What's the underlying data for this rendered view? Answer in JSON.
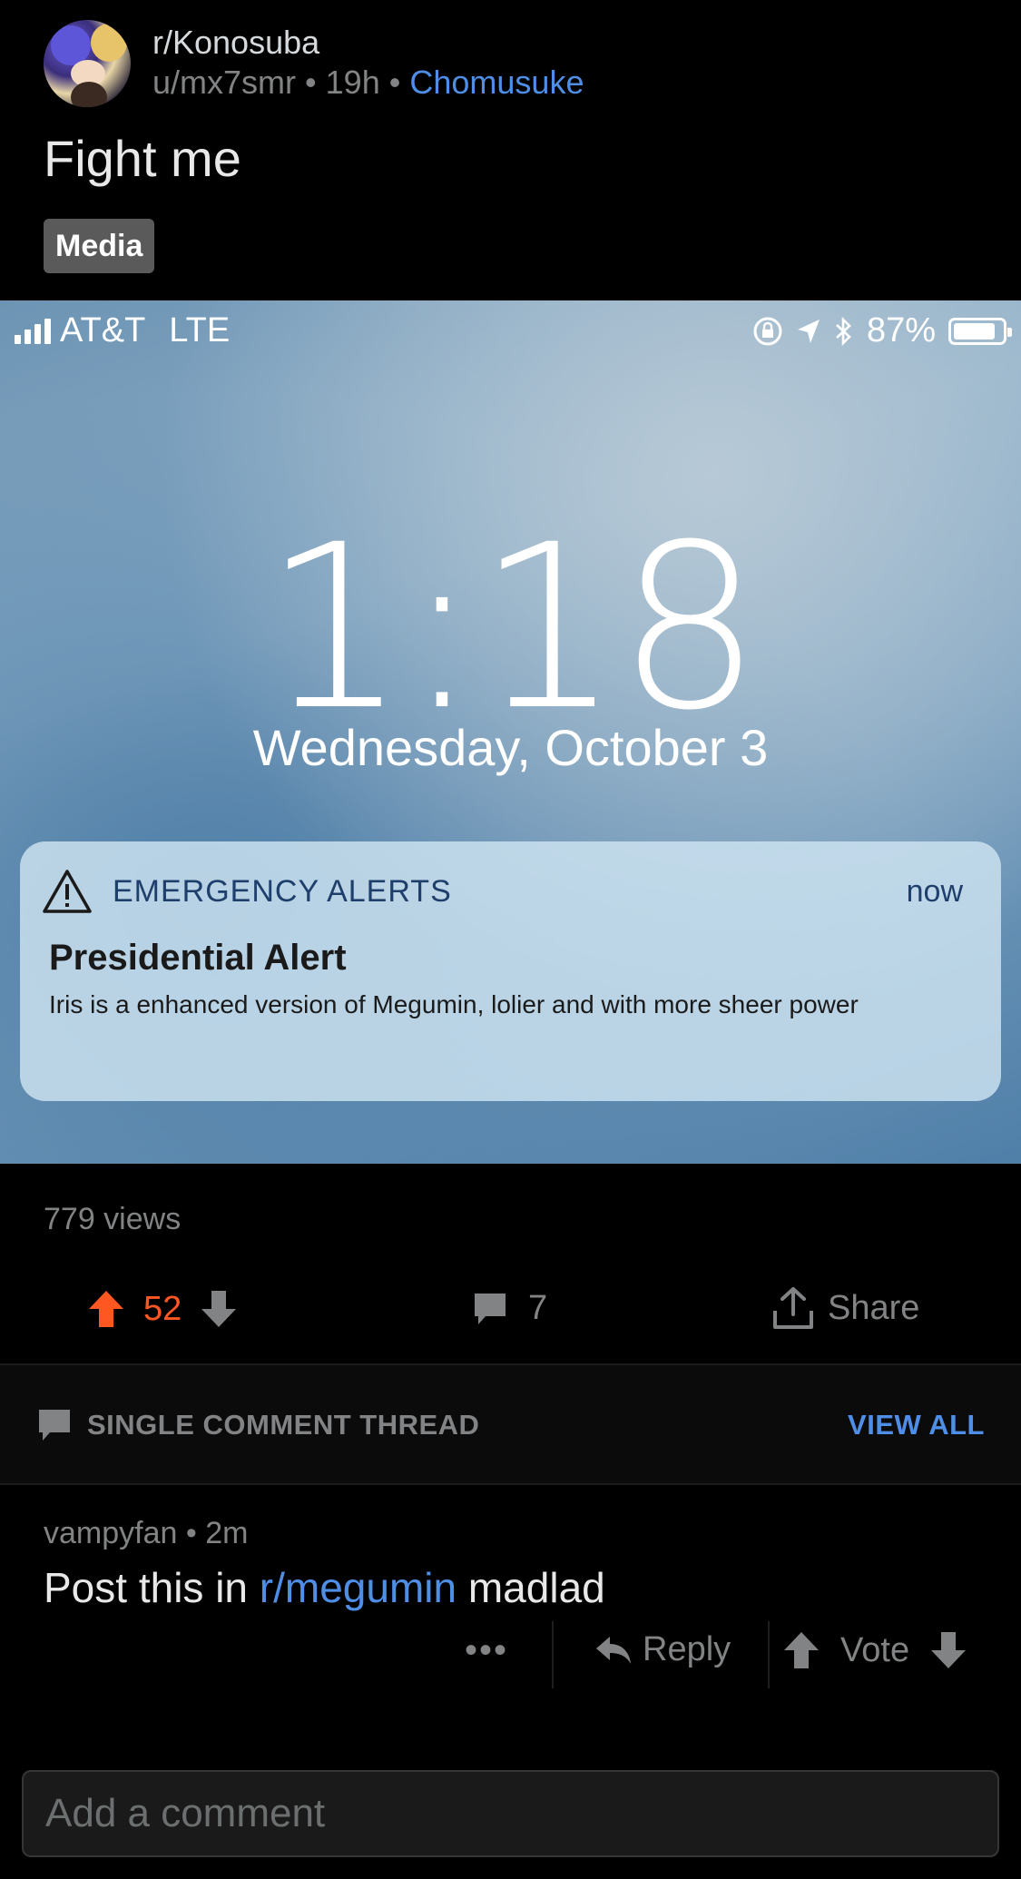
{
  "post": {
    "subreddit": "r/Konosuba",
    "username": "u/mx7smr",
    "age": "19h",
    "flair": "Chomusuke",
    "sep": "•",
    "title": "Fight me",
    "tag": "Media"
  },
  "media": {
    "carrier": "AT&T",
    "network": "LTE",
    "battery_text": "87%",
    "battery_level": 0.87,
    "clock": "1:18",
    "date": "Wednesday, October 3",
    "alert": {
      "app": "EMERGENCY ALERTS",
      "time": "now",
      "headline": "Presidential Alert",
      "body": "Iris is a enhanced version of Megumin, lolier and with more sheer power"
    }
  },
  "stats": {
    "views": "779 views",
    "score": "52",
    "comments": "7",
    "share_label": "Share"
  },
  "thread": {
    "label": "SINGLE COMMENT THREAD",
    "view_all": "VIEW ALL"
  },
  "comment": {
    "author": "vampyfan",
    "age": "2m",
    "sep": "•",
    "text_before": "Post this in ",
    "link": "r/megumin",
    "text_after": " madlad",
    "more": "•••",
    "reply_label": "Reply",
    "vote_label": "Vote"
  },
  "composer": {
    "placeholder": "Add a comment"
  },
  "colors": {
    "upvote": "#ff5722",
    "link": "#4f8ee6",
    "muted": "#818384"
  }
}
